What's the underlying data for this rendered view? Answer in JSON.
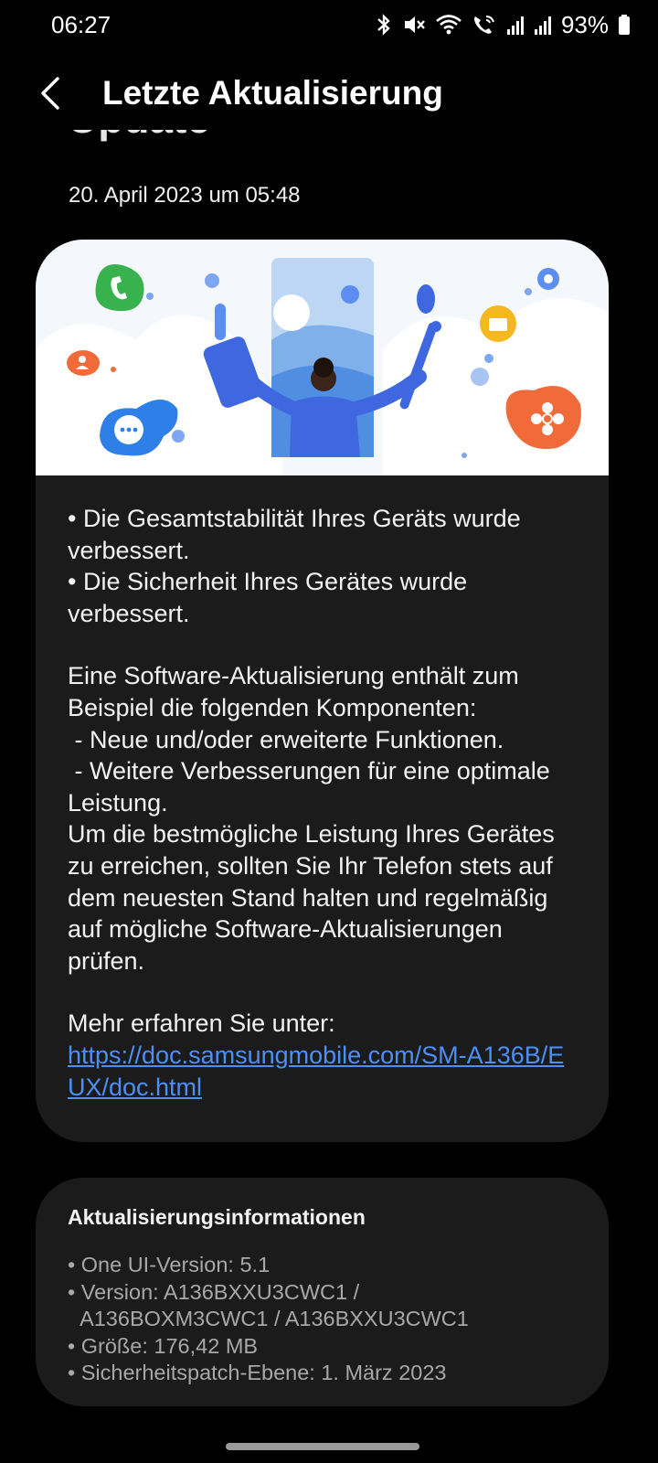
{
  "status_bar": {
    "time": "06:27",
    "battery_percent": "93%",
    "icons": [
      "bluetooth-icon",
      "mute-icon",
      "wifi-icon",
      "wifi-calling-icon",
      "signal-icon",
      "signal-icon",
      "battery-icon"
    ]
  },
  "app_bar": {
    "title": "Letzte Aktualisierung",
    "back_icon": "chevron-left-icon"
  },
  "update": {
    "heading_partial": "Update",
    "date": "20. April 2023 um 05:48",
    "illustration_icons": [
      "phone-call-icon",
      "person-icon",
      "chat-bubble-icon",
      "settings-gear-icon",
      "folder-icon",
      "flower-icon"
    ],
    "notes": {
      "line1": "• Die Gesamtstabilität Ihres Geräts wurde verbessert.",
      "line2": "• Die Sicherheit Ihres Gerätes wurde verbessert.",
      "para1": "Eine Software-Aktualisierung enthält zum Beispiel die folgenden Komponenten:",
      "item1": " - Neue und/oder erweiterte Funktionen.",
      "item2": " - Weitere Verbesserungen für eine optimale Leistung.",
      "para2": "Um die bestmögliche Leistung Ihres Gerätes zu erreichen, sollten Sie Ihr Telefon stets auf dem neuesten Stand halten und regelmäßig auf mögliche Software-Aktualisierungen prüfen.",
      "more_info_label": "Mehr erfahren Sie unter:",
      "link": "https://doc.samsungmobile.com/SM-A136B/EUX/doc.html"
    }
  },
  "info": {
    "title": "Aktualisierungsinformationen",
    "one_ui": "• One UI-Version: 5.1",
    "version_line1": "• Version: A136BXXU3CWC1 /",
    "version_line2": "  A136BOXM3CWC1 / A136BXXU3CWC1",
    "size": "• Größe: 176,42 MB",
    "security_patch": "• Sicherheitspatch-Ebene: 1. März 2023"
  },
  "colors": {
    "background": "#000000",
    "card": "#1b1b1b",
    "link": "#4d8ff5",
    "secondary_text": "#a8a8a8"
  }
}
